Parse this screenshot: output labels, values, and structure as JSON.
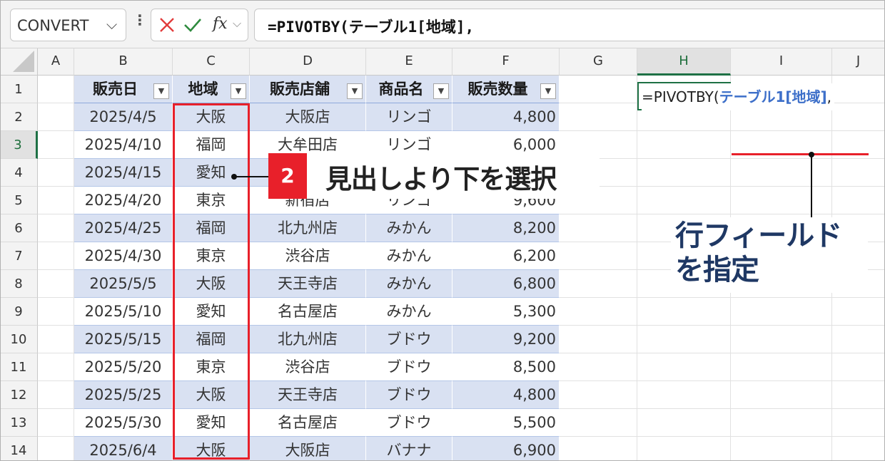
{
  "formula_bar": {
    "name_box": "CONVERT",
    "name_box_icon": "chevron-down-icon",
    "more_icon": "vertical-ellipsis-icon",
    "cancel_icon": "x-icon",
    "enter_icon": "check-icon",
    "fx_label": "fx",
    "fx_arrow_icon": "chevron-down-icon",
    "formula": "=PIVOTBY(テーブル1[地域],"
  },
  "columns": [
    "A",
    "B",
    "C",
    "D",
    "E",
    "F",
    "G",
    "H",
    "I",
    "J"
  ],
  "active_column": "H",
  "active_row": "3",
  "rows": [
    "1",
    "2",
    "3",
    "4",
    "5",
    "6",
    "7",
    "8",
    "9",
    "10",
    "11",
    "12",
    "13",
    "14"
  ],
  "table": {
    "headers": [
      "販売日",
      "地域",
      "販売店舗",
      "商品名",
      "販売数量"
    ],
    "rows": [
      [
        "2025/4/5",
        "大阪",
        "大阪店",
        "リンゴ",
        "4,800"
      ],
      [
        "2025/4/10",
        "福岡",
        "大牟田店",
        "リンゴ",
        "6,000"
      ],
      [
        "2025/4/15",
        "愛知",
        "",
        "",
        ""
      ],
      [
        "2025/4/20",
        "東京",
        "新宿店",
        "リンゴ",
        "9,600"
      ],
      [
        "2025/4/25",
        "福岡",
        "北九州店",
        "みかん",
        "8,200"
      ],
      [
        "2025/4/30",
        "東京",
        "渋谷店",
        "みかん",
        "6,200"
      ],
      [
        "2025/5/5",
        "大阪",
        "天王寺店",
        "みかん",
        "6,800"
      ],
      [
        "2025/5/10",
        "愛知",
        "名古屋店",
        "みかん",
        "5,300"
      ],
      [
        "2025/5/15",
        "福岡",
        "北九州店",
        "ブドウ",
        "9,200"
      ],
      [
        "2025/5/20",
        "東京",
        "渋谷店",
        "ブドウ",
        "8,500"
      ],
      [
        "2025/5/25",
        "大阪",
        "天王寺店",
        "ブドウ",
        "4,800"
      ],
      [
        "2025/5/30",
        "愛知",
        "名古屋店",
        "ブドウ",
        "5,500"
      ],
      [
        "2025/6/4",
        "大阪",
        "大阪店",
        "バナナ",
        "6,900"
      ]
    ],
    "filter_icon": "filter-dropdown-icon"
  },
  "h3_cell": {
    "prefix": "=PIVOTBY(",
    "reference": "テーブル1[地域]",
    "suffix": ","
  },
  "annotations": {
    "step_number": "2",
    "step_text": "見出しより下を選択",
    "note_line1": "行フィールド",
    "note_line2": "を指定"
  },
  "colors": {
    "accent_red": "#e8202a",
    "table_band": "#d9e1f2",
    "excel_green": "#1e7145",
    "reference_blue": "#3d6fc9",
    "note_navy": "#1f3864"
  }
}
